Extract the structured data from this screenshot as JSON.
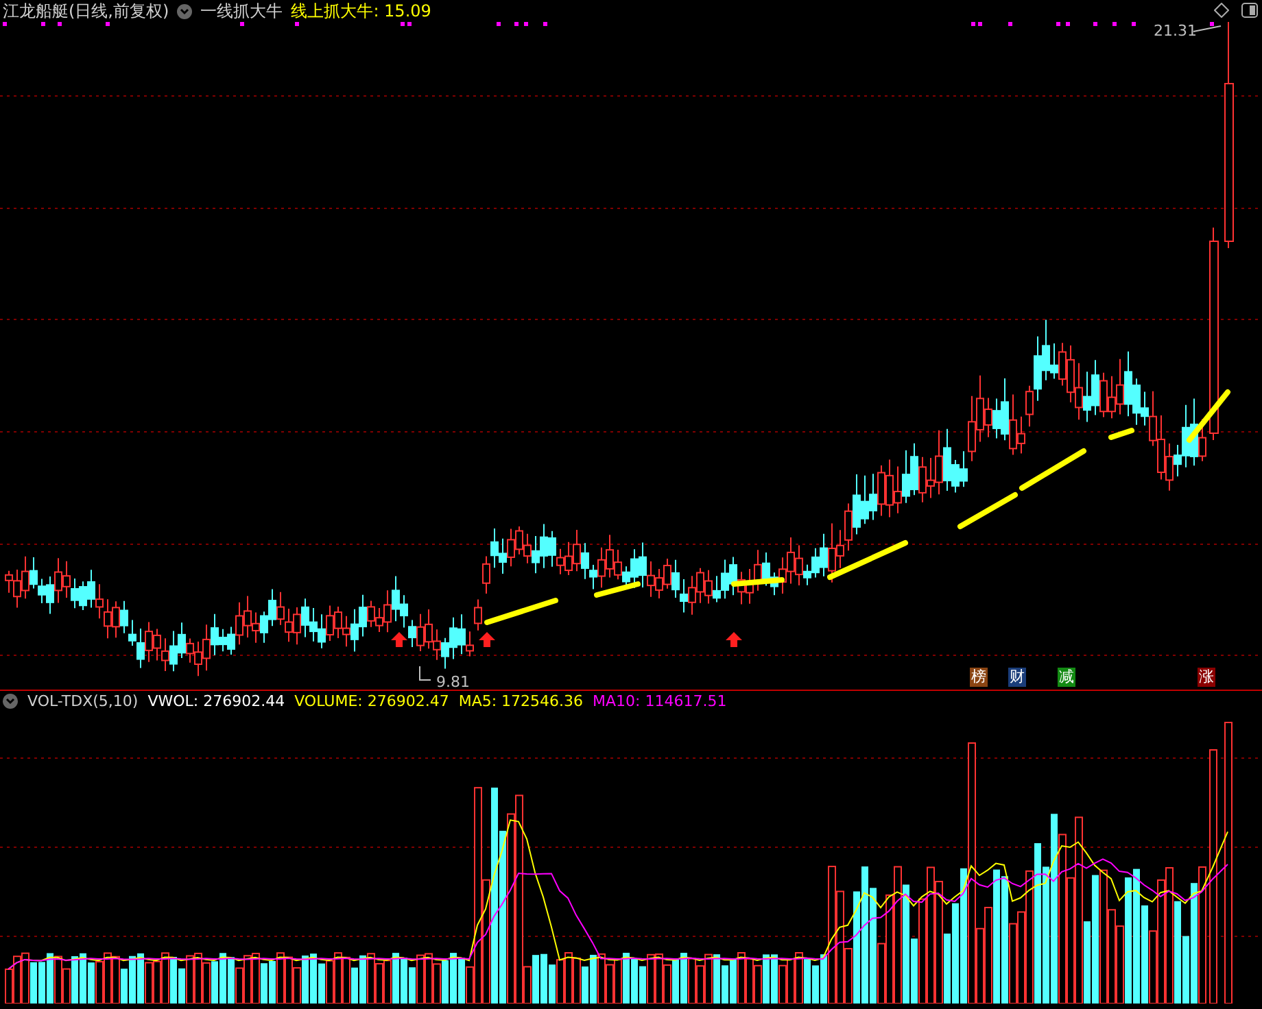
{
  "header": {
    "title": "江龙船艇(日线,前复权)",
    "indicator": "一线抓大牛",
    "reading": "线上抓大牛: 15.09"
  },
  "price_panel": {
    "high_label": "21.31",
    "low_label": "9.81",
    "badges": [
      {
        "label": "榜",
        "color": "#8b4513"
      },
      {
        "label": "财",
        "color": "#1a3d7a"
      },
      {
        "label": "减",
        "color": "#138a13"
      },
      {
        "label": "涨",
        "color": "#8b0000"
      }
    ]
  },
  "volume_panel": {
    "indicator": "VOL-TDX(5,10)",
    "readings": [
      {
        "text": "VWOL: 276902.44",
        "color": "#ffffff"
      },
      {
        "text": "VOLUME: 276902.47",
        "color": "#ffff00"
      },
      {
        "text": "MA5: 172546.36",
        "color": "#ffff00"
      },
      {
        "text": "MA10: 114617.51",
        "color": "#ff00ff"
      }
    ]
  }
}
